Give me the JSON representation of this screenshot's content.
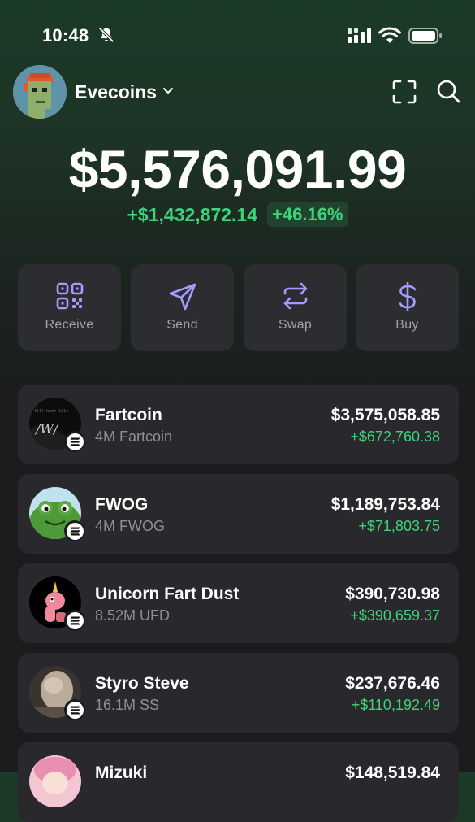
{
  "status_bar": {
    "time": "10:48"
  },
  "header": {
    "account_name": "Evecoins"
  },
  "balance": {
    "total": "$5,576,091.99",
    "change_abs": "+$1,432,872.14",
    "change_pct": "+46.16%"
  },
  "actions": [
    {
      "label": "Receive",
      "icon": "qr-code-icon"
    },
    {
      "label": "Send",
      "icon": "send-icon"
    },
    {
      "label": "Swap",
      "icon": "swap-icon"
    },
    {
      "label": "Buy",
      "icon": "dollar-icon"
    }
  ],
  "tokens": [
    {
      "name": "Fartcoin",
      "amount": "4M Fartcoin",
      "value": "$3,575,058.85",
      "change": "+$672,760.38"
    },
    {
      "name": "FWOG",
      "amount": "4M FWOG",
      "value": "$1,189,753.84",
      "change": "+$71,803.75"
    },
    {
      "name": "Unicorn Fart Dust",
      "amount": "8.52M UFD",
      "value": "$390,730.98",
      "change": "+$390,659.37"
    },
    {
      "name": "Styro Steve",
      "amount": "16.1M SS",
      "value": "$237,676.46",
      "change": "+$110,192.49"
    },
    {
      "name": "Mizuki",
      "amount": "",
      "value": "$148,519.84",
      "change": ""
    }
  ],
  "colors": {
    "accent": "#a89bff",
    "gain": "#3ed37a",
    "card": "#29292d",
    "muted": "#8e8e93"
  }
}
